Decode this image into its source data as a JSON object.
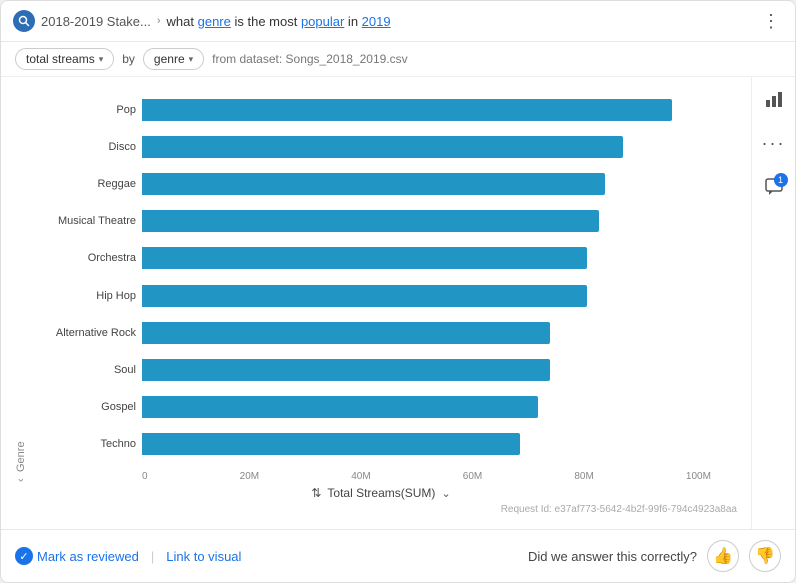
{
  "header": {
    "breadcrumb": "2018-2019 Stake...",
    "query_part1": "what ",
    "query_keyword1": "genre",
    "query_part2": " is the most ",
    "query_keyword2": "popular",
    "query_part3": " in ",
    "query_keyword3": "2019",
    "more_icon": "⋮"
  },
  "controls": {
    "metric_label": "total streams",
    "by_label": "by",
    "dimension_label": "genre",
    "dataset_label": "from dataset: Songs_2018_2019.csv"
  },
  "chart": {
    "y_axis_label": "Genre",
    "x_axis_label": "Total Streams(SUM)",
    "x_ticks": [
      "0",
      "20M",
      "40M",
      "60M",
      "80M",
      "100M"
    ],
    "bars": [
      {
        "label": "Pop",
        "value": "87M",
        "pct": 87
      },
      {
        "label": "Disco",
        "value": "79M",
        "pct": 79
      },
      {
        "label": "Reggae",
        "value": "76M",
        "pct": 76
      },
      {
        "label": "Musical Theatre",
        "value": "75M",
        "pct": 75
      },
      {
        "label": "Orchestra",
        "value": "73M",
        "pct": 73
      },
      {
        "label": "Hip Hop",
        "value": "73M",
        "pct": 73
      },
      {
        "label": "Alternative Rock",
        "value": "67M",
        "pct": 67
      },
      {
        "label": "Soul",
        "value": "67M",
        "pct": 67
      },
      {
        "label": "Gospel",
        "value": "65M",
        "pct": 65
      },
      {
        "label": "Techno",
        "value": "62M",
        "pct": 62
      }
    ],
    "request_id": "Request Id: e37af773-5642-4b2f-99f6-794c4923a8aa"
  },
  "right_panel": {
    "chart_icon": "📊",
    "more_icon": "⋯",
    "comment_icon": "💬",
    "badge_count": "1"
  },
  "footer": {
    "mark_reviewed": "Mark as reviewed",
    "link_visual": "Link to visual",
    "answer_question": "Did we answer this correctly?",
    "thumb_up": "👍",
    "thumb_down": "👎"
  }
}
